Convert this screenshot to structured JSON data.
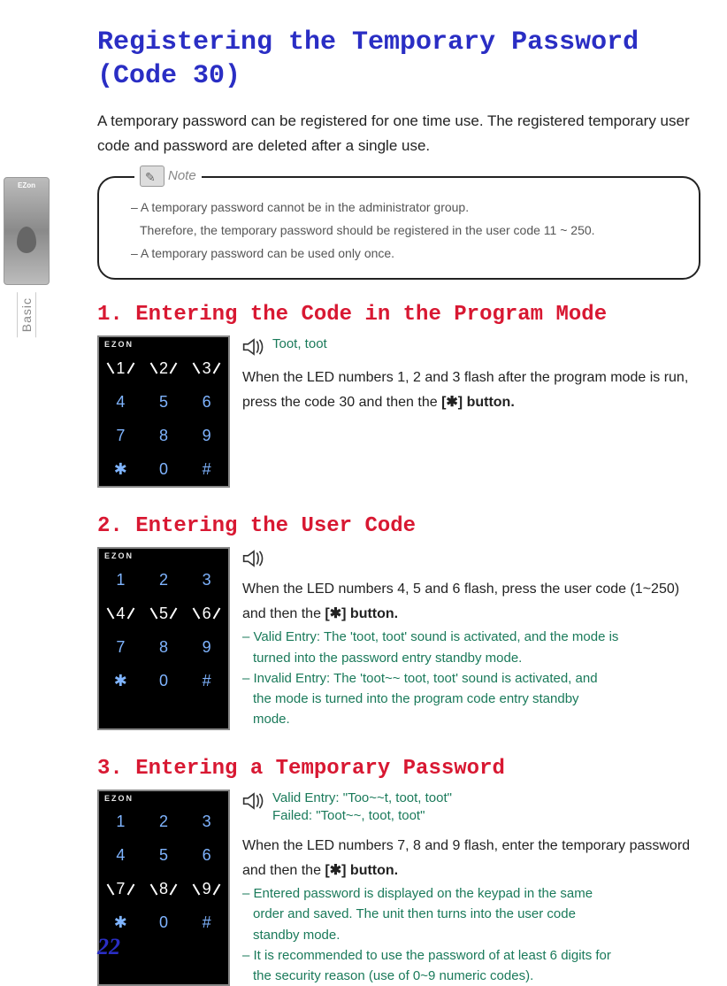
{
  "side": {
    "brand": "EZon",
    "basic": "Basic"
  },
  "title": "Registering the Temporary Password (Code 30)",
  "intro": "A temporary password can be registered for one time use. The registered temporary user code and password are deleted after a single use.",
  "note": {
    "label": "Note",
    "line1": "– A temporary password cannot be in the administrator group.",
    "line1b": "Therefore, the temporary password should be registered in the user code 11 ~ 250.",
    "line2": "– A temporary password can be used only once."
  },
  "keypad_brand": "EZON",
  "keys": {
    "k1": "1",
    "k2": "2",
    "k3": "3",
    "k4": "4",
    "k5": "5",
    "k6": "6",
    "k7": "7",
    "k8": "8",
    "k9": "9",
    "kstar": "✱",
    "k0": "0",
    "khash": "#"
  },
  "step1": {
    "heading": "1. Entering the Code in the Program Mode",
    "sound": "Toot, toot",
    "body_a": "When the LED numbers 1, 2 and 3 flash after the program mode is run, press the code 30 and then the ",
    "body_bold": "[✱] button."
  },
  "step2": {
    "heading": "2. Entering the User Code",
    "body_a": "When the LED numbers 4, 5 and 6 flash, press the user code (1~250) and then the ",
    "body_bold": "[✱] button.",
    "sub1": "– Valid Entry: The 'toot, toot' sound is activated, and the mode is",
    "sub1b": "turned into the password entry standby mode.",
    "sub2": "– Invalid Entry: The 'toot~~ toot, toot' sound is activated, and",
    "sub2b": "the mode is turned into the program code entry standby",
    "sub2c": "mode."
  },
  "step3": {
    "heading": "3. Entering a Temporary Password",
    "sound_a": "Valid Entry: \"Too~~t, toot, toot\"",
    "sound_b": "Failed: \"Toot~~, toot, toot\"",
    "body_a": "When the LED numbers 7, 8 and 9 flash, enter the temporary password and then the ",
    "body_bold": "[✱] button.",
    "sub1": "– Entered password is displayed on the keypad in the same",
    "sub1b": "order and saved. The unit then turns into the user code",
    "sub1c": "standby mode.",
    "sub2": "– It is recommended to use the password of at least 6 digits for",
    "sub2b": "the security reason (use of 0~9 numeric codes)."
  },
  "page_number": "22"
}
